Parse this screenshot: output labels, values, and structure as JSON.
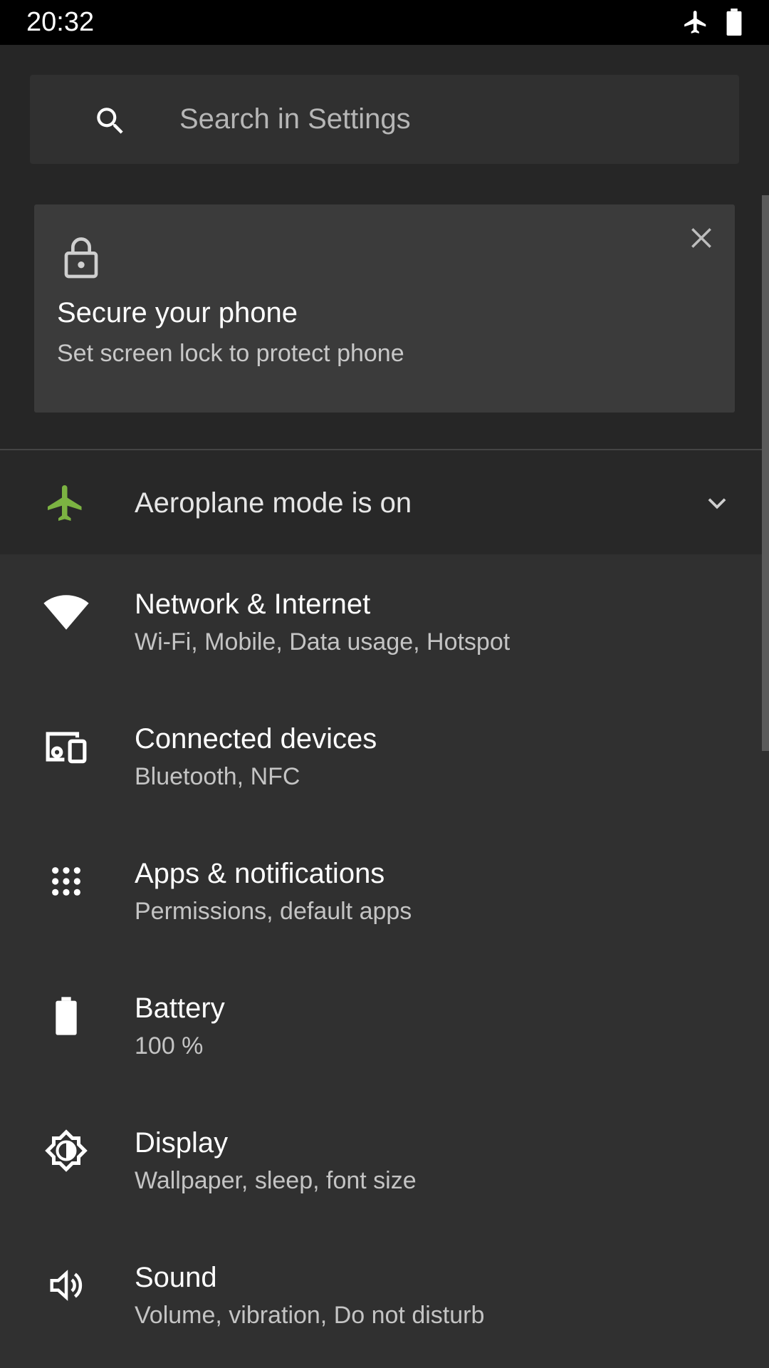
{
  "status_bar": {
    "time": "20:32",
    "icons": [
      "airplane-icon",
      "battery-icon"
    ]
  },
  "search": {
    "placeholder": "Search in Settings",
    "icon": "search-icon"
  },
  "suggestion": {
    "icon": "lock-icon",
    "title": "Secure your phone",
    "subtitle": "Set screen lock to protect phone",
    "dismiss_icon": "close-icon"
  },
  "condition": {
    "icon": "airplane-icon",
    "text": "Aeroplane mode is on",
    "accent_color": "#7cb342",
    "expand_icon": "chevron-down-icon"
  },
  "settings": [
    {
      "icon": "wifi-icon",
      "title": "Network & Internet",
      "subtitle": "Wi-Fi, Mobile, Data usage, Hotspot"
    },
    {
      "icon": "devices-icon",
      "title": "Connected devices",
      "subtitle": "Bluetooth, NFC"
    },
    {
      "icon": "apps-grid-icon",
      "title": "Apps & notifications",
      "subtitle": "Permissions, default apps"
    },
    {
      "icon": "battery-icon",
      "title": "Battery",
      "subtitle": "100 %"
    },
    {
      "icon": "brightness-icon",
      "title": "Display",
      "subtitle": "Wallpaper, sleep, font size"
    },
    {
      "icon": "volume-icon",
      "title": "Sound",
      "subtitle": "Volume, vibration, Do not disturb"
    }
  ]
}
